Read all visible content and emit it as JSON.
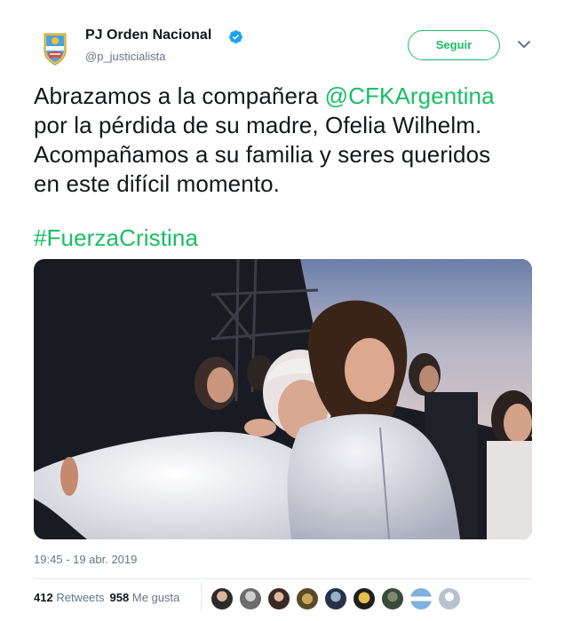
{
  "author": {
    "name": "PJ Orden Nacional",
    "handle": "@p_justicialista",
    "verified_icon": "verified-badge-icon",
    "avatar_icon": "party-shield-logo"
  },
  "follow_button": {
    "label": "Seguir"
  },
  "menu_icon": "chevron-down-icon",
  "tweet": {
    "line1_prefix": "Abrazamos a la compañera ",
    "mention": "@CFKArgentina",
    "line2": "por la pérdida de su madre, Ofelia Wilhelm.",
    "line3": "Acompañamos a su familia y seres queridos",
    "line4": "en este difícil momento.",
    "hashtag": "#FuerzaCristina"
  },
  "photo": {
    "icon": "photo-two-women-embracing"
  },
  "timestamp": "19:45 - 19 abr. 2019",
  "stats": {
    "retweets_count": "412",
    "retweets_label": "Retweets",
    "likes_count": "958",
    "likes_label": "Me gusta"
  },
  "likers_count_shown": 9,
  "colors": {
    "accent": "#17bf63",
    "text": "#14171a",
    "secondary": "#657786",
    "divider": "#e6ecf0",
    "verified": "#1da1f2"
  }
}
